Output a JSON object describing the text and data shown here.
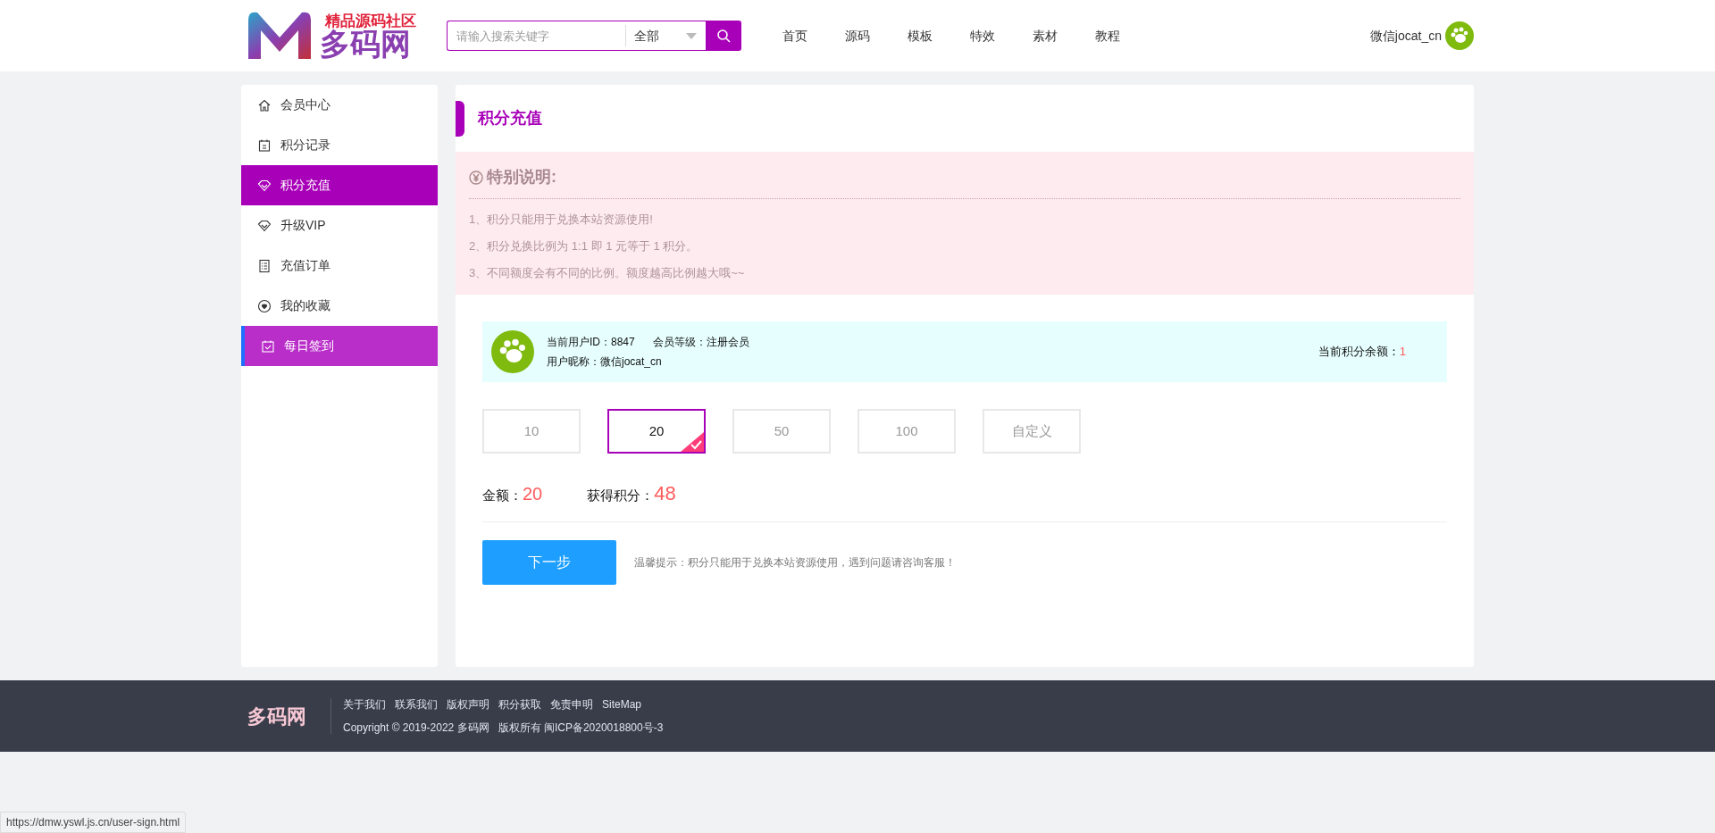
{
  "header": {
    "logo_tagline": "精品源码社区",
    "logo_name": "多码网",
    "search": {
      "placeholder": "请输入搜索关键字",
      "category": "全部"
    },
    "nav": [
      {
        "label": "首页"
      },
      {
        "label": "源码"
      },
      {
        "label": "模板"
      },
      {
        "label": "特效"
      },
      {
        "label": "素材"
      },
      {
        "label": "教程"
      }
    ],
    "user": "微信jocat_cn"
  },
  "sidebar": {
    "items": [
      {
        "label": "会员中心",
        "selected": false,
        "hovered": false
      },
      {
        "label": "积分记录",
        "selected": false,
        "hovered": false
      },
      {
        "label": "积分充值",
        "selected": true,
        "hovered": false
      },
      {
        "label": "升级VIP",
        "selected": false,
        "hovered": false
      },
      {
        "label": "充值订单",
        "selected": false,
        "hovered": false
      },
      {
        "label": "我的收藏",
        "selected": false,
        "hovered": false
      },
      {
        "label": "每日签到",
        "selected": false,
        "hovered": true
      }
    ]
  },
  "main": {
    "title": "积分充值",
    "notice": {
      "title": "特别说明:",
      "lines": [
        "1、积分只能用于兑换本站资源使用!",
        "2、积分兑换比例为 1:1 即 1 元等于 1 积分。",
        "3、不同额度会有不同的比例。额度越高比例越大哦~~"
      ]
    },
    "user_card": {
      "user_id": "当前用户ID：8847",
      "level": "会员等级：注册会员",
      "nickname": "用户昵称：微信jocat_cn",
      "balance_label": "当前积分余额：",
      "balance": "1"
    },
    "amounts": [
      {
        "label": "10",
        "selected": false
      },
      {
        "label": "20",
        "selected": true
      },
      {
        "label": "50",
        "selected": false
      },
      {
        "label": "100",
        "selected": false
      },
      {
        "label": "自定义",
        "selected": false
      }
    ],
    "amount_label": "金额：",
    "amount": "20",
    "points_label": "获得积分：",
    "points": "48",
    "next_button": "下一步",
    "tip": "温馨提示：积分只能用于兑换本站资源使用，遇到问题请咨询客服！"
  },
  "footer": {
    "logo": "多码网",
    "links": [
      "关于我们",
      "联系我们",
      "版权声明",
      "积分获取",
      "免责申明",
      "SiteMap"
    ],
    "copyright": "Copyright © 2019-2022 多码网   版权所有 闽ICP备2020018800号-3"
  },
  "status_url": "https://dmw.yswl.js.cn/user-sign.html"
}
